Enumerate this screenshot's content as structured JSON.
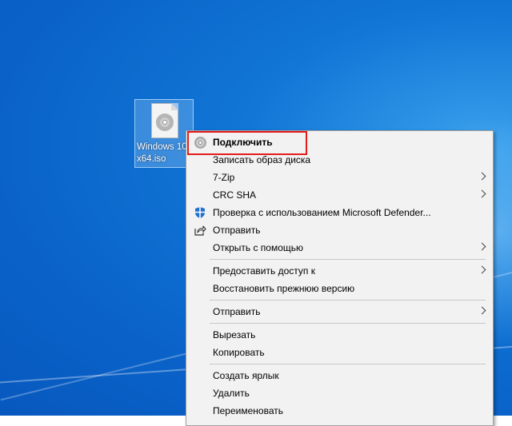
{
  "desktop": {
    "icon": {
      "name": "iso-disc-file-icon",
      "label": "Windows 10_x64.iso"
    }
  },
  "context_menu": {
    "items": [
      {
        "label": "Подключить",
        "bold": true,
        "icon": "disc-icon",
        "submenu": false
      },
      {
        "label": "Записать образ диска",
        "submenu": false
      },
      {
        "label": "7-Zip",
        "submenu": true
      },
      {
        "label": "CRC SHA",
        "submenu": true
      },
      {
        "label": "Проверка с использованием Microsoft Defender...",
        "icon": "defender-shield-icon",
        "submenu": false
      },
      {
        "label": "Отправить",
        "icon": "share-icon",
        "submenu": false
      },
      {
        "label": "Открыть с помощью",
        "submenu": true
      },
      {
        "label": "Предоставить доступ к",
        "submenu": true
      },
      {
        "label": "Восстановить прежнюю версию",
        "submenu": false
      },
      {
        "label": "Отправить",
        "submenu": true
      },
      {
        "label": "Вырезать",
        "submenu": false
      },
      {
        "label": "Копировать",
        "submenu": false
      },
      {
        "label": "Создать ярлык",
        "submenu": false
      },
      {
        "label": "Удалить",
        "submenu": false
      },
      {
        "label": "Переименовать",
        "submenu": false
      }
    ]
  },
  "colors": {
    "highlight_border": "#e31b1b",
    "desktop_blue": "#0a63c9",
    "menu_background": "#f2f2f2",
    "defender_blue": "#1f6fcf"
  }
}
